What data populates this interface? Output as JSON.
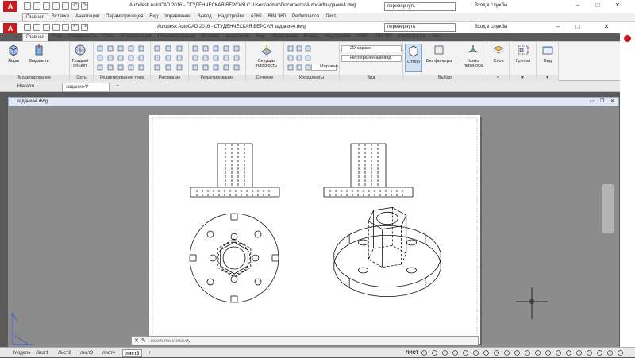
{
  "back_window": {
    "logo_letter": "A",
    "title": "Autodesk AutoCAD 2016 - СТУДЕНЧЕСКАЯ ВЕРСИЯ    C:\\Users\\admin\\Documents\\Autocad\\задание4.dwg",
    "search_value": "перевернуть",
    "signin": "Вход в службы",
    "tabs": [
      "Главная",
      "Вставка",
      "Аннотации",
      "Параметризация",
      "Вид",
      "Управление",
      "Вывод",
      "Надстройки",
      "A360",
      "BIM 360",
      "Performance",
      "Лист"
    ]
  },
  "window": {
    "logo_letter": "A",
    "title": "Autodesk AutoCAD 2016 - СТУДЕНЧЕСКАЯ ВЕРСИЯ    задание4.dwg",
    "search_value": "перевернуть",
    "signin": "Вход в службы",
    "tabs": [
      "Главная",
      "Тело",
      "Поверхность",
      "Сеть",
      "Визуализация",
      "Параметризация",
      "Вставка",
      "Аннотации",
      "Вид",
      "Управление",
      "Вывод",
      "Надстройки",
      "A360",
      "BIM 360",
      "Performance",
      "Лист"
    ]
  },
  "ribbon": {
    "panels": {
      "modeling": "Моделирование",
      "mesh": "Сеть",
      "solid_edit": "Редактирование тела",
      "draw": "Рисование",
      "modify": "Редактирование",
      "section": "Сечение",
      "coordinates": "Координаты",
      "view": "Вид",
      "selection": "Выбор"
    },
    "buttons": {
      "box": "Ящик",
      "extrude": "Выдавить",
      "smooth": "Гладкий объект",
      "section_plane": "Секущая плоскость",
      "culling": "Отбор",
      "no_filter": "Без фильтра",
      "gizmo": "Гизмо переноса",
      "layers": "Слои",
      "groups": "Группы",
      "view": "Вид"
    },
    "combos": {
      "visual_style": "2D-каркас",
      "view_state": "Несохраненный вид",
      "ucs": "Мировая"
    }
  },
  "doc_tabs": [
    "Начало",
    "задание4*"
  ],
  "drawing_window": {
    "title": "задание4.dwg"
  },
  "command_line": {
    "placeholder": "Введите команду"
  },
  "layout_tabs": [
    "Модель",
    "Лист1",
    "Лист2",
    "лист3",
    "лист4",
    "лист5"
  ],
  "active_layout": "лист5",
  "status": {
    "mode": "ЛИСТ"
  },
  "colors": {
    "accent_red": "#c41e1e",
    "paper": "#ffffff",
    "canvas": "#8c8c8c"
  }
}
